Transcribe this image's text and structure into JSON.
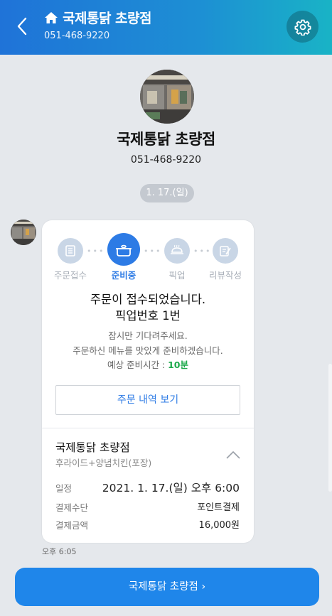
{
  "header": {
    "title": "국제통닭 초량점",
    "phone": "051-468-9220"
  },
  "profile": {
    "name": "국제통닭 초량점",
    "phone": "051-468-9220"
  },
  "date_divider": "1. 17.(일)",
  "progress": {
    "steps": [
      {
        "label": "주문접수",
        "icon": "receipt-icon",
        "active": false
      },
      {
        "label": "준비중",
        "icon": "cooking-pot-icon",
        "active": true
      },
      {
        "label": "픽업",
        "icon": "food-tray-icon",
        "active": false
      },
      {
        "label": "리뷰작성",
        "icon": "review-pen-icon",
        "active": false
      }
    ]
  },
  "message": {
    "title_line1": "주문이 접수되었습니다.",
    "title_line2": "픽업번호 1번",
    "sub_line1": "잠시만 기다려주세요.",
    "sub_line2": "주문하신 메뉴를 맛있게 준비하겠습니다.",
    "prep_label": "예상 준비시간 : ",
    "prep_value": "10분",
    "order_button": "주문 내역 보기"
  },
  "details": {
    "store_name": "국제통닭 초량점",
    "menu": "후라이드+양념치킨(포장)",
    "rows": [
      {
        "label": "일정",
        "value": "2021. 1. 17.(일) 오후 6:00"
      },
      {
        "label": "결제수단",
        "value": "포인트결제"
      },
      {
        "label": "결제금액",
        "value": "16,000원"
      }
    ]
  },
  "timestamp": "오후 6:05",
  "bottom_button": "국제통닭 초량점 ›",
  "colors": {
    "accent": "#2d7be5",
    "step_inactive": "#c9d6e6",
    "highlight": "#1ca94a",
    "bottom_button": "#1f86ea"
  }
}
